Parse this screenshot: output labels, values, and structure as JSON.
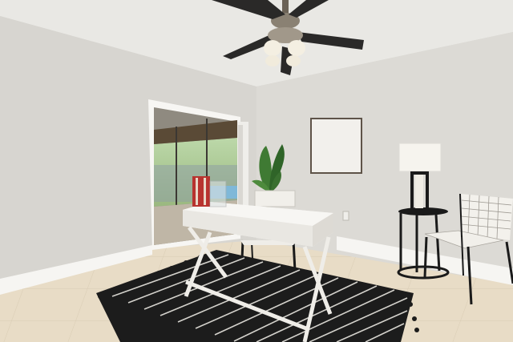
{
  "palette": {
    "ceiling": "#e9e8e4",
    "wall_left": "#d7d5d0",
    "wall_right": "#dcdad5",
    "floor": "#e8dcc6",
    "baseboard": "#f6f5f2",
    "fan_dark": "#2a2928",
    "fan_light": "#f4efe2",
    "foliage": "#3f7a33",
    "desk_white": "#f4f2ee",
    "rug_dark": "#1c1c1c",
    "rug_stripe": "#e8e6e0",
    "lamp_shade": "#f6f4ee",
    "metal_black": "#1a1a1a",
    "book_red": "#b8332f"
  }
}
